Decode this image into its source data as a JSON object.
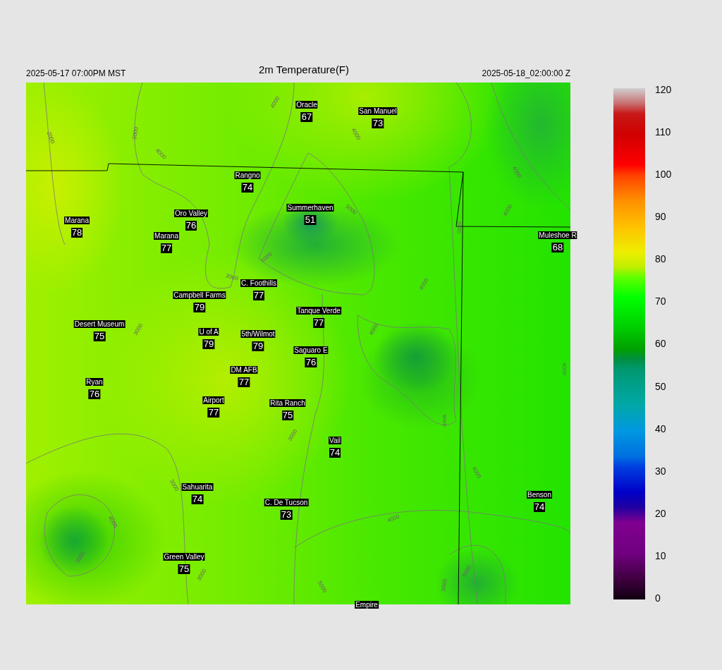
{
  "header": {
    "valid_local": "2025-05-17 07:00PM MST",
    "title": "2m Temperature(F)",
    "valid_utc": "2025-05-18_02:00:00 Z"
  },
  "map": {
    "stations": [
      {
        "name": "Oracle",
        "value": "67"
      },
      {
        "name": "San Manuel",
        "value": "73"
      },
      {
        "name": "Rangno",
        "value": "74"
      },
      {
        "name": "Summerhaven",
        "value": "51"
      },
      {
        "name": "Marana",
        "value": "78"
      },
      {
        "name": "Oro Valley",
        "value": "76"
      },
      {
        "name": "Marana",
        "value": "77"
      },
      {
        "name": "Muleshoe R",
        "value": "68"
      },
      {
        "name": "C. Foothills",
        "value": "77"
      },
      {
        "name": "Campbell Farms",
        "value": "79"
      },
      {
        "name": "Tanque Verde",
        "value": "77"
      },
      {
        "name": "Desert Museum",
        "value": "75"
      },
      {
        "name": "U of A",
        "value": "79"
      },
      {
        "name": "5th/Wilmot",
        "value": "79"
      },
      {
        "name": "Saguaro E",
        "value": "76"
      },
      {
        "name": "DM AFB",
        "value": "77"
      },
      {
        "name": "Ryan",
        "value": "76"
      },
      {
        "name": "Airport",
        "value": "77"
      },
      {
        "name": "Rita Ranch",
        "value": "75"
      },
      {
        "name": "Vail",
        "value": "74"
      },
      {
        "name": "Sahuarita",
        "value": "74"
      },
      {
        "name": "Benson",
        "value": "74"
      },
      {
        "name": "C. De Tucson",
        "value": "73"
      },
      {
        "name": "Green Valley",
        "value": "75"
      },
      {
        "name": "Empire"
      }
    ],
    "contour_labels": [
      "2000",
      "3000",
      "4000",
      "4000",
      "4000",
      "5000",
      "5000",
      "3000",
      "3000",
      "3000",
      "4000",
      "4000",
      "4000",
      "4000",
      "4000",
      "4000",
      "4000",
      "3000",
      "3000",
      "4000",
      "3000",
      "4000",
      "3000",
      "5000",
      "3000",
      "5000"
    ]
  },
  "colorbar": {
    "ticks": [
      "120",
      "110",
      "100",
      "90",
      "80",
      "70",
      "60",
      "50",
      "40",
      "30",
      "20",
      "10",
      "0"
    ]
  }
}
